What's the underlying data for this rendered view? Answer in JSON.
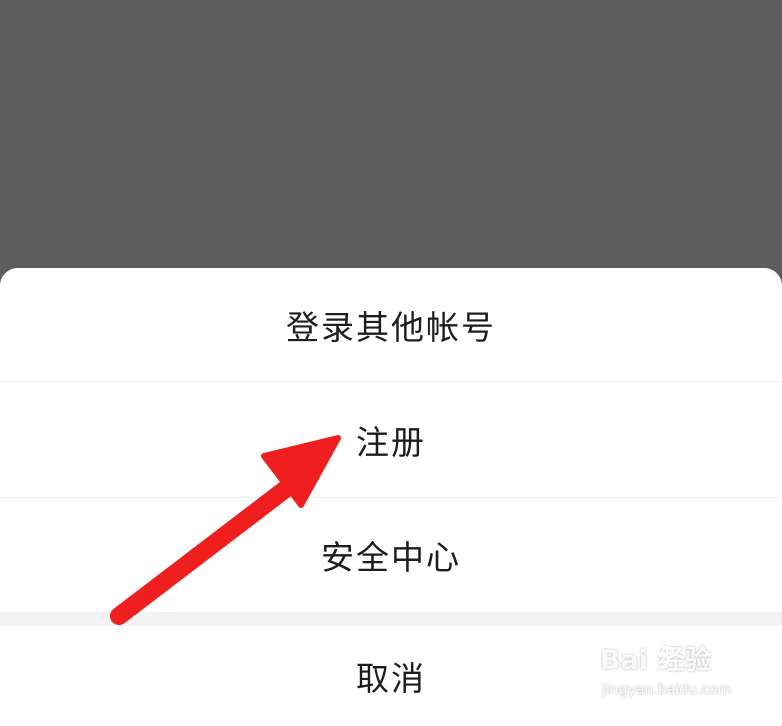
{
  "action_sheet": {
    "options": [
      {
        "label": "登录其他帐号"
      },
      {
        "label": "注册"
      },
      {
        "label": "安全中心"
      }
    ],
    "cancel_label": "取消"
  },
  "annotation": {
    "arrow_color": "#f01f1f",
    "points_to": "注册"
  },
  "watermark": {
    "logo_text": "Bai 经验",
    "url": "jingyan.baidu.com"
  },
  "colors": {
    "overlay": "#5e5e5e",
    "sheet": "#ffffff",
    "text": "#1d1d1d"
  }
}
